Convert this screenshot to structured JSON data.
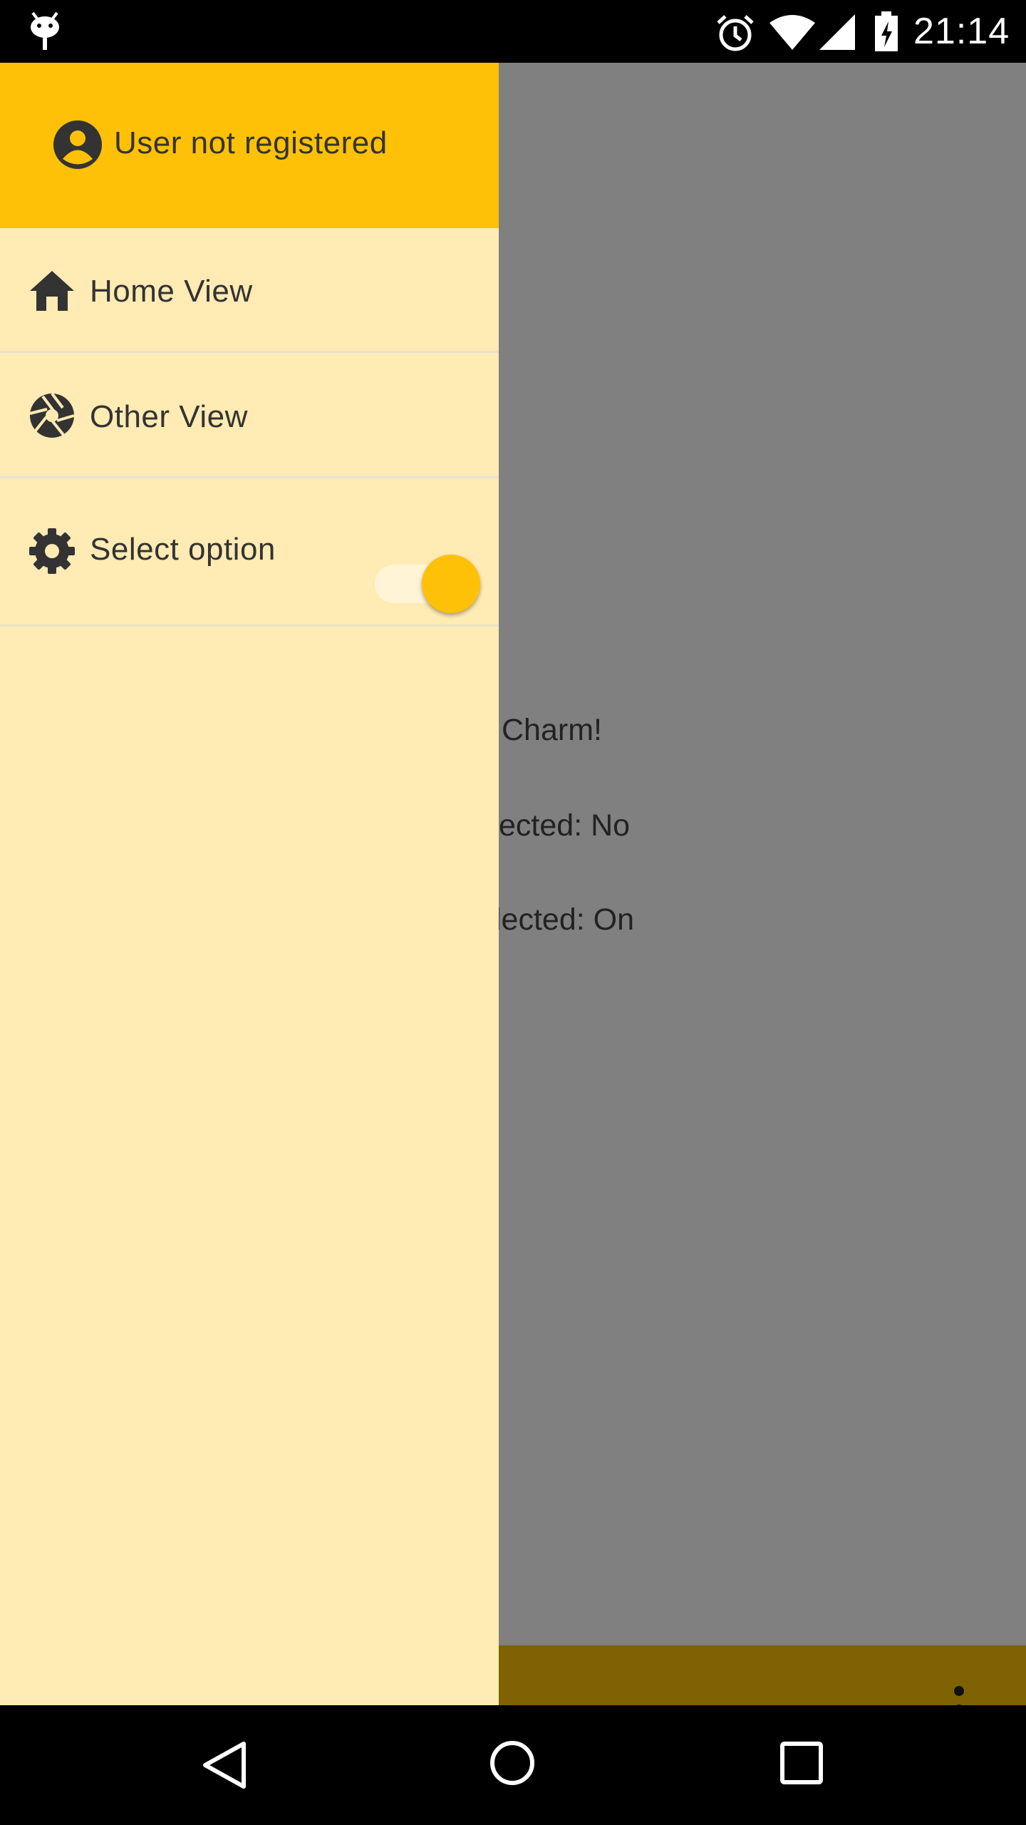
{
  "status_bar": {
    "time": "21:14",
    "icons": [
      "debug-icon",
      "alarm-icon",
      "wifi-icon",
      "signal-icon",
      "battery-charging-icon"
    ]
  },
  "drawer": {
    "header": {
      "icon": "account-circle-icon",
      "user_label": "User not registered"
    },
    "items": [
      {
        "icon": "home-icon",
        "label": "Home View"
      },
      {
        "icon": "aperture-icon",
        "label": "Other View"
      },
      {
        "icon": "gear-icon",
        "label": "Select option",
        "switch_on": true
      }
    ]
  },
  "background_content": {
    "lines": [
      "Charm!",
      "ected: No",
      "lected: On"
    ]
  },
  "colors": {
    "accent": "#ffc107",
    "drawer_bg": "#ffebb3",
    "scrim": "#808080",
    "bottom_bar": "#7f6204"
  }
}
